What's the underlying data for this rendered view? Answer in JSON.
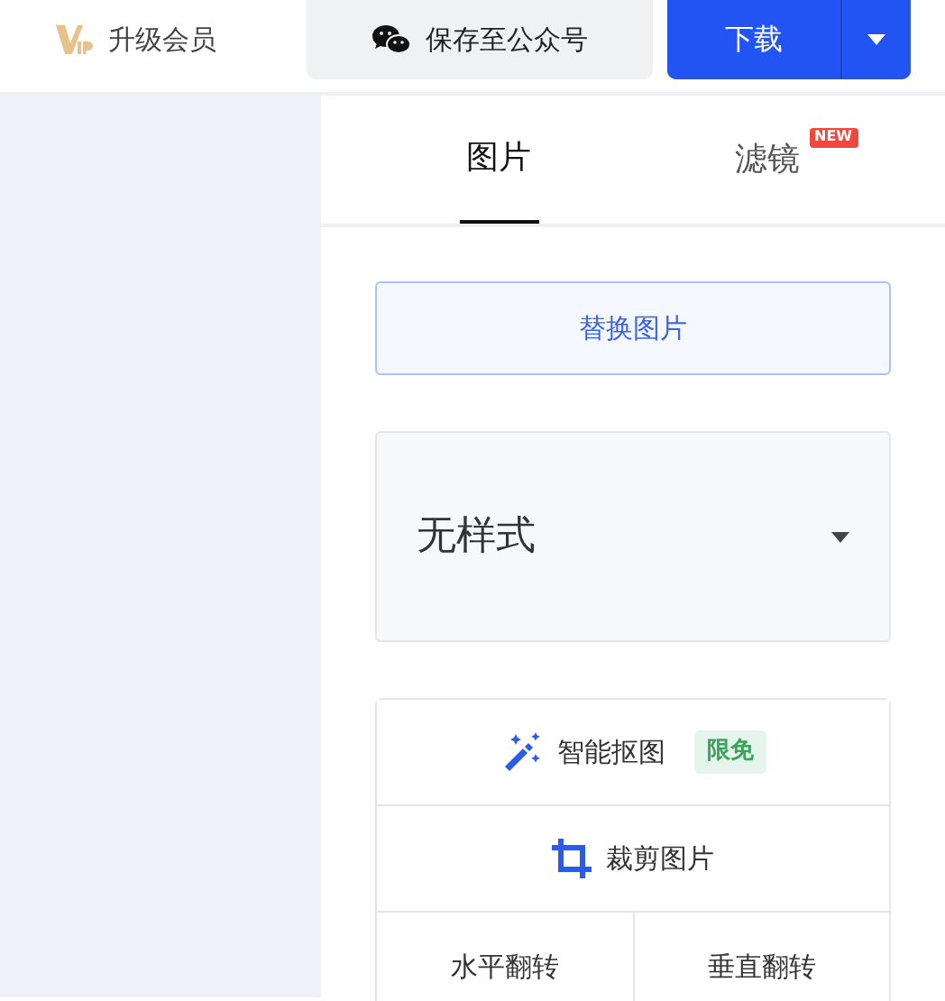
{
  "header": {
    "vip_label": "升级会员",
    "save_button": "保存至公众号",
    "download_button": "下载"
  },
  "tabs": [
    {
      "label": "图片",
      "selected": true
    },
    {
      "label": "滤镜",
      "selected": false,
      "badge": "NEW"
    }
  ],
  "replace_button": "替换图片",
  "style_select": {
    "value": "无样式"
  },
  "tools": [
    {
      "kind": "wand",
      "label": "智能抠图",
      "badge": "限免"
    },
    {
      "kind": "crop",
      "label": "裁剪图片"
    }
  ],
  "flip_buttons": [
    "水平翻转",
    "垂直翻转"
  ]
}
